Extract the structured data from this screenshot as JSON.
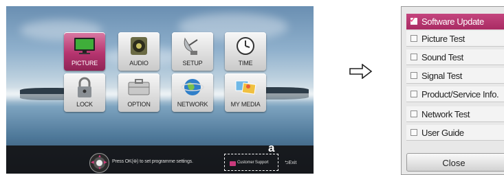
{
  "tv": {
    "menu": [
      {
        "label": "PICTURE",
        "icon": "tv-picture-icon",
        "active": true
      },
      {
        "label": "AUDIO",
        "icon": "speaker-icon",
        "active": false
      },
      {
        "label": "SETUP",
        "icon": "satellite-dish-icon",
        "active": false
      },
      {
        "label": "TIME",
        "icon": "clock-icon",
        "active": false
      },
      {
        "label": "LOCK",
        "icon": "padlock-icon",
        "active": false
      },
      {
        "label": "OPTION",
        "icon": "toolbox-icon",
        "active": false
      },
      {
        "label": "NETWORK",
        "icon": "globe-network-icon",
        "active": false
      },
      {
        "label": "MY MEDIA",
        "icon": "media-photos-icon",
        "active": false
      }
    ],
    "hint": "Press OK(⊛) to set programme settings.",
    "customer_support": "Customer Support",
    "exit": "Exit",
    "callout": "a"
  },
  "arrow": "right-outline-arrow-icon",
  "popup": {
    "items": [
      {
        "label": "Software Update",
        "checked": true
      },
      {
        "label": "Picture Test",
        "checked": false
      },
      {
        "label": "Sound Test",
        "checked": false
      },
      {
        "label": "Signal Test",
        "checked": false
      },
      {
        "label": "Product/Service Info.",
        "checked": false
      },
      {
        "label": "Network Test",
        "checked": false
      },
      {
        "label": "User Guide",
        "checked": false
      }
    ],
    "close_label": "Close"
  },
  "colors": {
    "accent": "#b6346f",
    "bar": "#141416",
    "popup_bg": "#e8e8e8"
  }
}
